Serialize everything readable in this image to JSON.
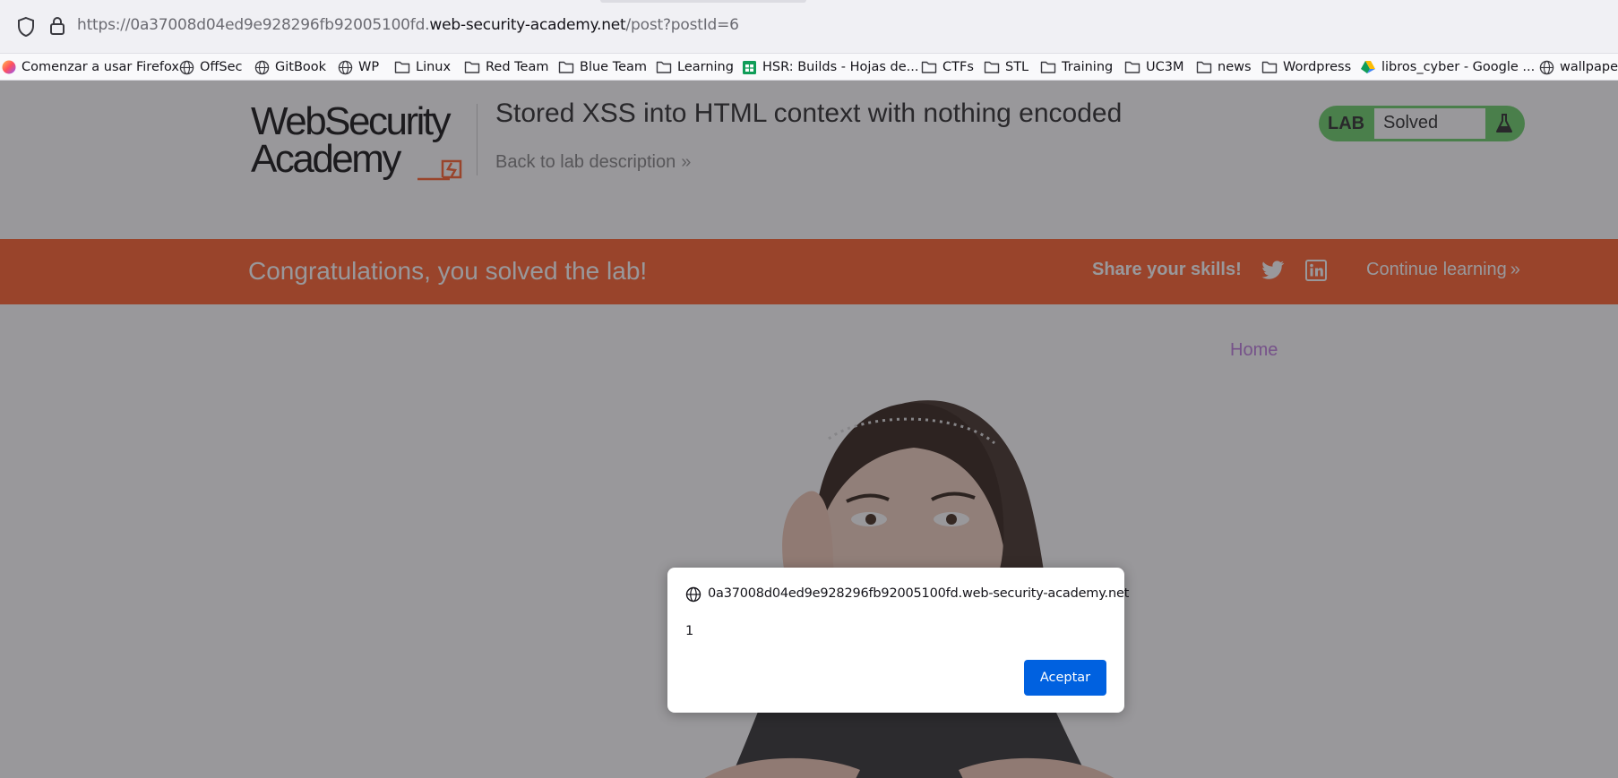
{
  "browser": {
    "url_prefix": "https://0a37008d04ed9e928296fb92005100fd.",
    "url_host": "web-security-academy.net",
    "url_path": "/post?postId=6"
  },
  "bookmarks": [
    {
      "label": "Comenzar a usar Firefox",
      "icon": "firefox-icon"
    },
    {
      "label": "OffSec",
      "icon": "globe-icon"
    },
    {
      "label": "GitBook",
      "icon": "globe-icon"
    },
    {
      "label": "WP",
      "icon": "globe-icon"
    },
    {
      "label": "Linux",
      "icon": "folder-icon"
    },
    {
      "label": "Red Team",
      "icon": "folder-icon"
    },
    {
      "label": "Blue Team",
      "icon": "folder-icon"
    },
    {
      "label": "Learning",
      "icon": "folder-icon"
    },
    {
      "label": "HSR: Builds - Hojas de...",
      "icon": "sheets-icon"
    },
    {
      "label": "CTFs",
      "icon": "folder-icon"
    },
    {
      "label": "STL",
      "icon": "folder-icon"
    },
    {
      "label": "Training",
      "icon": "folder-icon"
    },
    {
      "label": "UC3M",
      "icon": "folder-icon"
    },
    {
      "label": "news",
      "icon": "folder-icon"
    },
    {
      "label": "Wordpress",
      "icon": "folder-icon"
    },
    {
      "label": "libros_cyber - Google ...",
      "icon": "drive-icon"
    },
    {
      "label": "wallpapers",
      "icon": "globe-icon"
    }
  ],
  "header": {
    "logo_line1": "WebSecurity",
    "logo_line2": "Academy",
    "lab_title": "Stored XSS into HTML context with nothing encoded",
    "back_link": "Back to lab description",
    "back_chevron": "»",
    "badge_label": "LAB",
    "badge_status": "Solved"
  },
  "banner": {
    "message": "Congratulations, you solved the lab!",
    "share_label": "Share your skills!",
    "continue_label": "Continue learning",
    "continue_chevron": "»"
  },
  "nav": {
    "home_label": "Home"
  },
  "dialog": {
    "origin": "0a37008d04ed9e928296fb92005100fd.web-security-academy.net",
    "message": "1",
    "ok_label": "Aceptar"
  },
  "colors": {
    "banner": "#ff6633",
    "badge": "#70d16d",
    "home_link": "#c080e0",
    "dialog_button": "#0061e0"
  }
}
